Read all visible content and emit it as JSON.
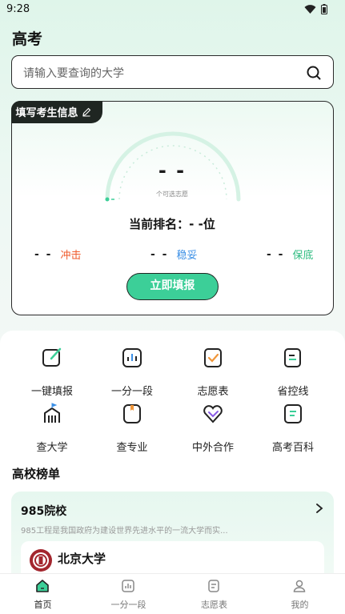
{
  "status_bar": {
    "time": "9:28"
  },
  "header": {
    "title": "高考"
  },
  "search": {
    "placeholder": "请输入要查询的大学"
  },
  "info_card": {
    "tag_label": "填写考生信息",
    "gauge_value": "- -",
    "gauge_caption": "个可选志愿",
    "rank_text": "当前排名：- -位",
    "stats": [
      {
        "value": "- -",
        "label": "冲击",
        "color": "#ef5a2b"
      },
      {
        "value": "- -",
        "label": "稳妥",
        "color": "#3b8fe6"
      },
      {
        "value": "- -",
        "label": "保底",
        "color": "#2dbb7f"
      }
    ],
    "button_label": "立即填报"
  },
  "features": [
    {
      "label": "一键填报",
      "icon": "edit-icon"
    },
    {
      "label": "一分一段",
      "icon": "bar-chart-icon"
    },
    {
      "label": "志愿表",
      "icon": "checklist-icon"
    },
    {
      "label": "省控线",
      "icon": "document-icon"
    },
    {
      "label": "查大学",
      "icon": "university-icon"
    },
    {
      "label": "查专业",
      "icon": "bookmark-icon"
    },
    {
      "label": "中外合作",
      "icon": "heart-icon"
    },
    {
      "label": "高考百科",
      "icon": "book-icon"
    }
  ],
  "rankings": {
    "section_title": "高校榜单",
    "card_title": "985院校",
    "card_desc": "985工程是我国政府为建设世界先进水平的一流大学而实...",
    "university": "北京大学"
  },
  "bottom_nav": [
    {
      "label": "首页",
      "icon": "home-icon",
      "active": true
    },
    {
      "label": "一分一段",
      "icon": "bar-chart-icon",
      "active": false
    },
    {
      "label": "志愿表",
      "icon": "checklist-icon",
      "active": false
    },
    {
      "label": "我的",
      "icon": "user-icon",
      "active": false
    }
  ],
  "colors": {
    "accent": "#3ccf98",
    "dark": "#1f2622"
  }
}
